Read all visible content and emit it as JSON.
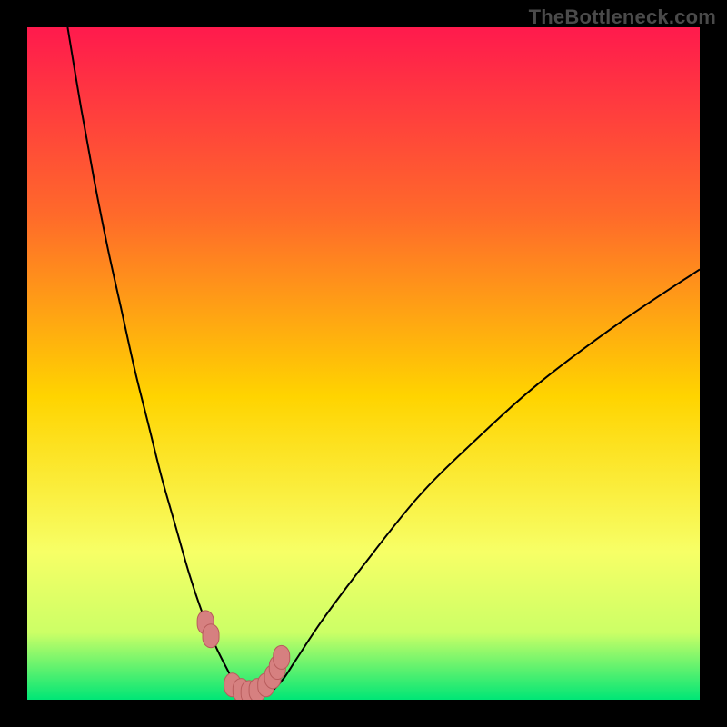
{
  "watermark": "TheBottleneck.com",
  "colors": {
    "frame": "#000000",
    "gradient_top": "#ff1a4d",
    "gradient_upper_mid": "#ff6a2a",
    "gradient_mid": "#ffd400",
    "gradient_lower_mid": "#f7ff66",
    "gradient_near_bottom": "#ccff66",
    "gradient_bottom": "#00e676",
    "curve": "#000000",
    "marker_fill": "#d68080",
    "marker_stroke": "#b85c5c"
  },
  "chart_data": {
    "type": "line",
    "title": "",
    "xlabel": "",
    "ylabel": "",
    "xlim": [
      0,
      100
    ],
    "ylim": [
      0,
      100
    ],
    "grid": false,
    "legend": false,
    "series": [
      {
        "name": "bottleneck-curve",
        "x": [
          6,
          8,
          10,
          12,
          14,
          16,
          18,
          20,
          22,
          24,
          26,
          28,
          30,
          31,
          32,
          33,
          34,
          36,
          38,
          40,
          44,
          50,
          58,
          66,
          76,
          88,
          100
        ],
        "y": [
          100,
          88,
          77,
          67,
          58,
          49,
          41,
          33,
          26,
          19,
          13,
          8,
          4,
          2,
          1,
          0.5,
          0.5,
          1,
          3,
          6,
          12,
          20,
          30,
          38,
          47,
          56,
          64
        ]
      }
    ],
    "markers": {
      "name": "highlight-points",
      "x": [
        26.5,
        27.3,
        30.5,
        31.8,
        33.0,
        34.2,
        35.5,
        36.5,
        37.2,
        37.8
      ],
      "y": [
        11.5,
        9.5,
        2.2,
        1.4,
        1.1,
        1.4,
        2.2,
        3.4,
        4.8,
        6.3
      ]
    },
    "note": "Axes are unlabeled in the source image; x/y scales are normalized 0-100. The curve is a V-shaped bottleneck profile with minimum near x≈33. The left branch rises steeply to 100; the right branch rises more gradually to ≈64 at the right edge."
  }
}
